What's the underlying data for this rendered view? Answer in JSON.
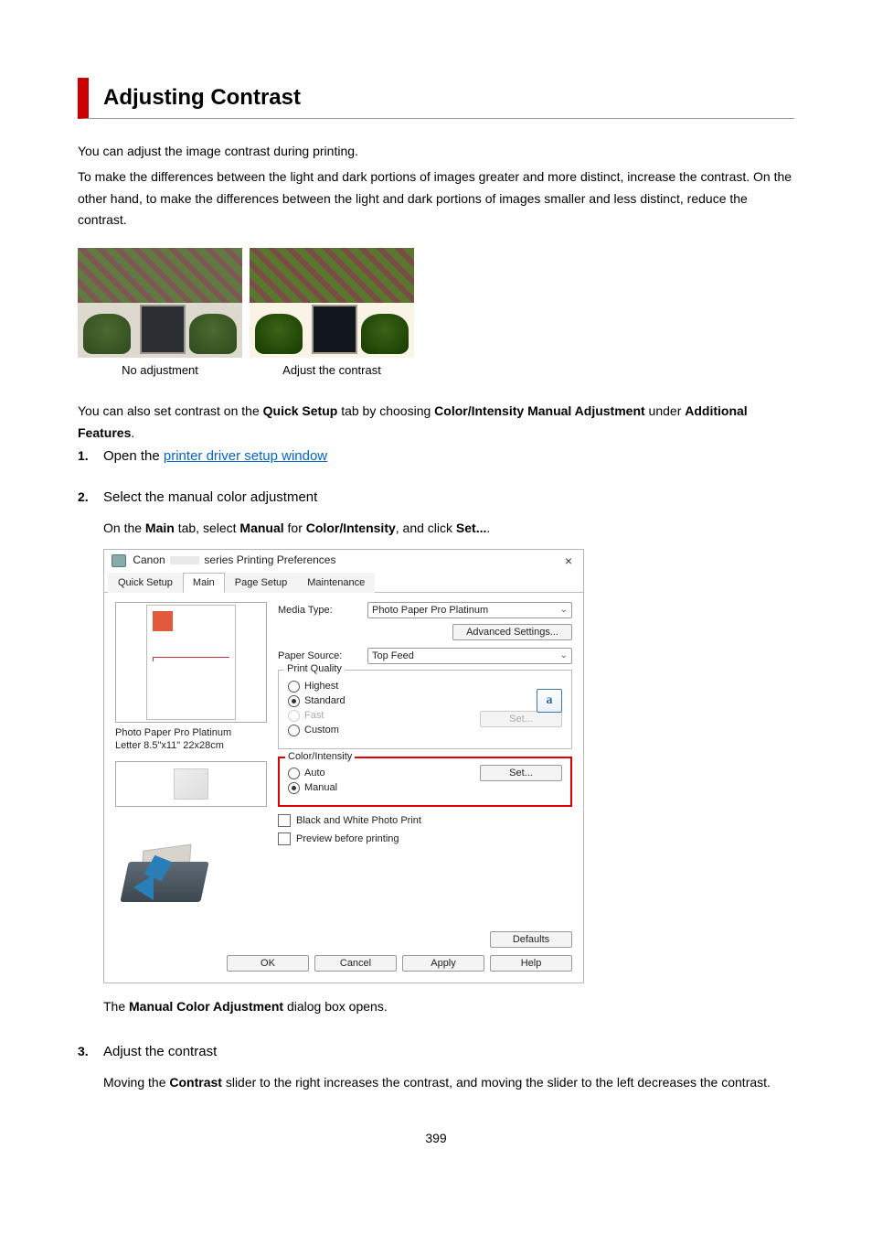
{
  "title": "Adjusting Contrast",
  "intro1": "You can adjust the image contrast during printing.",
  "intro2": "To make the differences between the light and dark portions of images greater and more distinct, increase the contrast. On the other hand, to make the differences between the light and dark portions of images smaller and less distinct, reduce the contrast.",
  "captions": {
    "noadj": "No adjustment",
    "adj": "Adjust the contrast"
  },
  "also_prefix": "You can also set contrast on the ",
  "also_quick": "Quick Setup",
  "also_mid": " tab by choosing ",
  "also_cim": "Color/Intensity Manual Adjustment",
  "also_under": " under ",
  "also_af": "Additional Features",
  "also_dot": ".",
  "steps": [
    {
      "num": "1.",
      "title_plain": "Open the ",
      "title_link": "printer driver setup window"
    },
    {
      "num": "2.",
      "title": "Select the manual color adjustment",
      "body_pre": "On the ",
      "body_main": "Main",
      "body_mid1": " tab, select ",
      "body_manual": "Manual",
      "body_mid2": " for ",
      "body_ci": "Color/Intensity",
      "body_mid3": ", and click ",
      "body_set": "Set...",
      "body_dot": ".",
      "closing_pre": "The ",
      "closing_mca": "Manual Color Adjustment",
      "closing_post": " dialog box opens."
    },
    {
      "num": "3.",
      "title": "Adjust the contrast",
      "body_pre": "Moving the ",
      "body_contrast": "Contrast",
      "body_post": " slider to the right increases the contrast, and moving the slider to the left decreases the contrast."
    }
  ],
  "dialog": {
    "title_prefix": "Canon",
    "title_suffix": "series Printing Preferences",
    "close": "×",
    "tabs": {
      "quick": "Quick Setup",
      "main": "Main",
      "page": "Page Setup",
      "maint": "Maintenance"
    },
    "labels": {
      "media_type": "Media Type:",
      "paper_source": "Paper Source:",
      "print_quality": "Print Quality",
      "color_intensity": "Color/Intensity"
    },
    "values": {
      "media_type": "Photo Paper Pro Platinum",
      "paper_source": "Top Feed"
    },
    "buttons": {
      "adv": "Advanced Settings...",
      "set_disabled": "Set...",
      "set": "Set...",
      "defaults": "Defaults",
      "ok": "OK",
      "cancel": "Cancel",
      "apply": "Apply",
      "help": "Help"
    },
    "radios": {
      "highest": "Highest",
      "standard": "Standard",
      "fast": "Fast",
      "custom": "Custom",
      "auto": "Auto",
      "manual": "Manual"
    },
    "checks": {
      "bw": "Black and White Photo Print",
      "preview": "Preview before printing"
    },
    "paper_info1": "Photo Paper Pro Platinum",
    "paper_info2": "Letter 8.5\"x11\" 22x28cm",
    "a_icon": "a"
  },
  "page_number": "399"
}
